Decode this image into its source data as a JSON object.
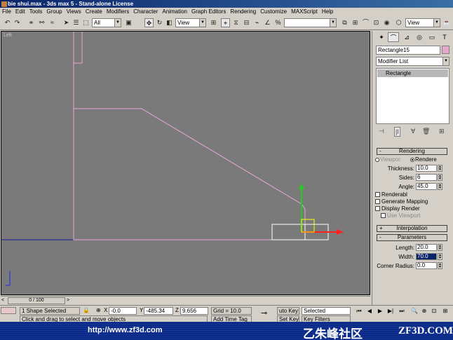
{
  "window": {
    "title": "bie shui.max - 3ds max 5 - Stand-alone License"
  },
  "menu": [
    "File",
    "Edit",
    "Tools",
    "Group",
    "Views",
    "Create",
    "Modifiers",
    "Character",
    "Animation",
    "Graph Editors",
    "Rendering",
    "Customize",
    "MAXScript",
    "Help"
  ],
  "toolbar": {
    "selection_filter": "All",
    "ref_coord": "View",
    "named_sel": "",
    "view_right": "View"
  },
  "viewport": {
    "label": "Left",
    "shape_color": "#e6a8d8",
    "gizmo_y_color": "#22cc22",
    "gizmo_x_color": "#ff2020"
  },
  "time": {
    "slider": "0 / 100"
  },
  "command_panel": {
    "object_name": "Rectangle15",
    "object_color": "#e6a8c8",
    "modifier_list": "Modifier List",
    "stack_item": "Rectangle",
    "rendering": {
      "title": "Rendering",
      "viewport_radio": "Viewpor",
      "renderer_radio": "Rendere",
      "thickness_label": "Thickness:",
      "thickness": "10.0",
      "sides_label": "Sides:",
      "sides": "6",
      "angle_label": "Angle:",
      "angle": "45.0",
      "renderable": "Renderabl",
      "gen_mapping": "Generate Mapping",
      "display_render": "Display Render",
      "use_viewport": "Use Viewport"
    },
    "interpolation_title": "Interpolation",
    "parameters": {
      "title": "Parameters",
      "length_label": "Length:",
      "length": "20.0",
      "width_label": "Width:",
      "width": "70.0",
      "corner_label": "Corner Radius:",
      "corner": "0.0"
    }
  },
  "status": {
    "selection": "1 Shape Selected",
    "x_label": "X",
    "x": "-0.0",
    "y_label": "Y",
    "y": "-485.34",
    "z_label": "Z",
    "z": "9.656",
    "grid": "Grid = 10.0",
    "auto_key": "uto Key",
    "set_key": "Set Key",
    "key_mode": "Selected",
    "key_filters": "Key Filters",
    "prompt": "Click and drag to select and move objects",
    "add_time_tag": "Add Time Tag"
  },
  "banner": {
    "url": "http://www.zf3d.com",
    "brand": "乙朱峰社区",
    "site": "ZF3D.COM"
  }
}
